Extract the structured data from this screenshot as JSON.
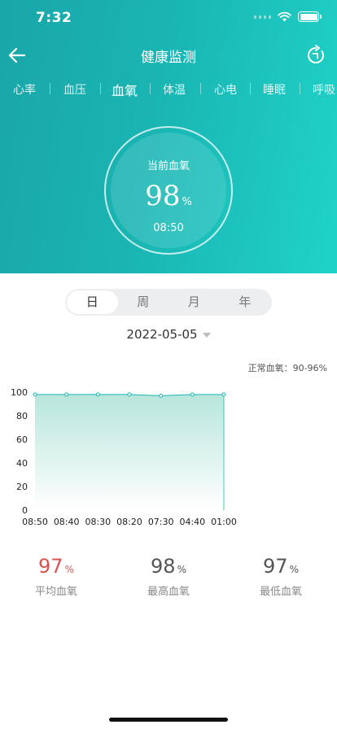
{
  "status_bar": {
    "time": "7:32"
  },
  "nav": {
    "title": "健康监测"
  },
  "tabs": [
    {
      "label": "心率",
      "active": false
    },
    {
      "label": "血压",
      "active": false
    },
    {
      "label": "血氧",
      "active": true
    },
    {
      "label": "体温",
      "active": false
    },
    {
      "label": "心电",
      "active": false
    },
    {
      "label": "睡眠",
      "active": false
    },
    {
      "label": "呼吸",
      "active": false
    }
  ],
  "gauge": {
    "label": "当前血氧",
    "value": "98",
    "unit": "%",
    "time": "08:50"
  },
  "period_tabs": [
    {
      "label": "日",
      "active": true
    },
    {
      "label": "周",
      "active": false
    },
    {
      "label": "月",
      "active": false
    },
    {
      "label": "年",
      "active": false
    }
  ],
  "date": "2022-05-05",
  "normal_range": "正常血氧：90-96%",
  "chart_data": {
    "type": "area",
    "title": "",
    "xlabel": "",
    "ylabel": "",
    "x": [
      "08:50",
      "08:40",
      "08:30",
      "08:20",
      "07:30",
      "04:40",
      "01:00"
    ],
    "series": [
      {
        "values": [
          98,
          98,
          98,
          98,
          97,
          98,
          98
        ]
      }
    ],
    "yticks": [
      0,
      20,
      40,
      60,
      80,
      100
    ],
    "ylim": [
      0,
      100
    ],
    "grid": false,
    "colors": {
      "line": "#1ab5b3",
      "fill_top": "#b7e6dc",
      "fill_bottom": "#ffffff"
    }
  },
  "stats": [
    {
      "value": "97",
      "unit": "%",
      "label": "平均血氧",
      "color": "#d9534f"
    },
    {
      "value": "98",
      "unit": "%",
      "label": "最高血氧",
      "color": "#555555"
    },
    {
      "value": "97",
      "unit": "%",
      "label": "最低血氧",
      "color": "#555555"
    }
  ]
}
